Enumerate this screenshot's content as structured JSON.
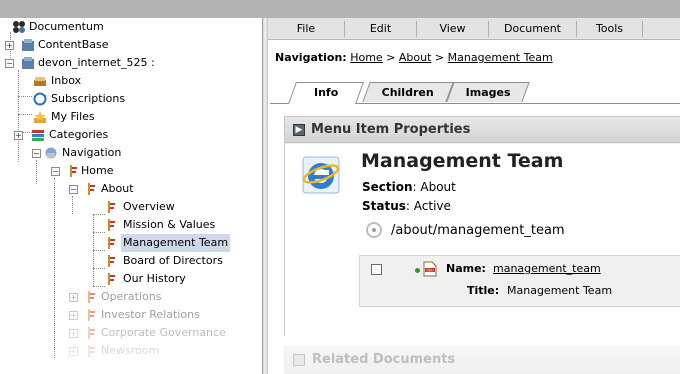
{
  "tree": {
    "root": "Documentum",
    "content_base": "ContentBase",
    "docbase": "devon_internet_525 :",
    "inbox": "Inbox",
    "subscriptions": "Subscriptions",
    "my_files": "My Files",
    "categories": "Categories",
    "navigation": "Navigation",
    "home": "Home",
    "about": "About",
    "overview": "Overview",
    "mission": "Mission & Values",
    "management": "Management Team",
    "board": "Board of Directors",
    "history": "Our History",
    "operations": "Operations",
    "investor": "Investor Relations",
    "governance": "Corporate Governance",
    "newsroom": "Newsroom"
  },
  "menubar": {
    "file": "File",
    "edit": "Edit",
    "view": "View",
    "document": "Document",
    "tools": "Tools"
  },
  "breadcrumb": {
    "label": "Navigation:",
    "home": "Home",
    "sep": ">",
    "about": "About",
    "current": "Management Team"
  },
  "tabs": {
    "info": "Info",
    "children": "Children",
    "images": "Images"
  },
  "panel": {
    "title": "Menu Item Properties",
    "item_title": "Management Team",
    "section_label": "Section",
    "section_value": ": About",
    "status_label": "Status",
    "status_value": ": Active",
    "path": "/about/management_team",
    "name_label": "Name:",
    "name_value": "management_team",
    "title_label": "Title:",
    "title_value": "Management Team"
  },
  "related": {
    "title": "Related Documents"
  },
  "colors": {
    "selection": "#cfd8ea",
    "status_dot": "#2e9e2e",
    "topbar": "#b3b3b3"
  }
}
